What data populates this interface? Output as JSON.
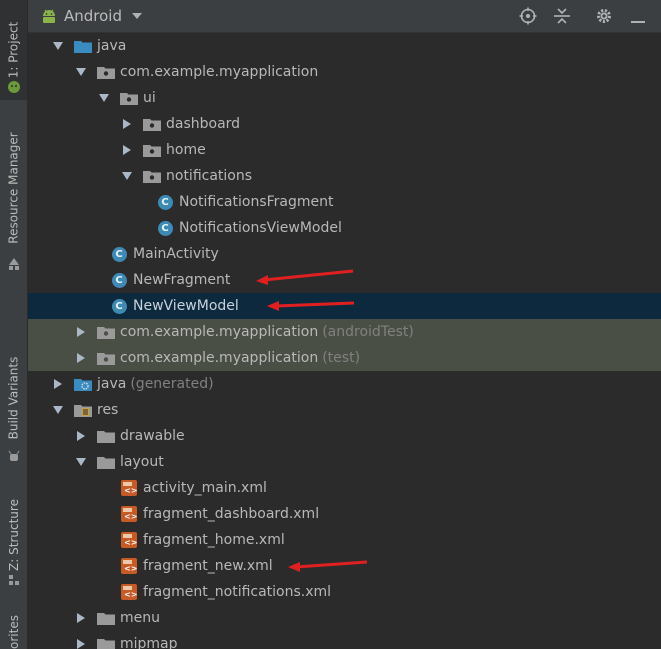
{
  "side_tabs": {
    "project": "1: Project",
    "resource_manager": "Resource Manager",
    "build_variants": "Build Variants",
    "structure": "Z: Structure",
    "favorites": "orites"
  },
  "toolbar": {
    "title": "Android"
  },
  "tree": {
    "java": "java",
    "package": "com.example.myapplication",
    "ui": "ui",
    "dashboard": "dashboard",
    "home": "home",
    "notifications": "notifications",
    "notifications_fragment": "NotificationsFragment",
    "notifications_viewmodel": "NotificationsViewModel",
    "main_activity": "MainActivity",
    "new_fragment": "NewFragment",
    "new_viewmodel": "NewViewModel",
    "package_android_test": "com.example.myapplication",
    "android_test_suffix": "(androidTest)",
    "package_test": "com.example.myapplication",
    "test_suffix": "(test)",
    "java_generated": "java",
    "generated_suffix": "(generated)",
    "res": "res",
    "drawable": "drawable",
    "layout": "layout",
    "activity_main": "activity_main.xml",
    "fragment_dashboard": "fragment_dashboard.xml",
    "fragment_home": "fragment_home.xml",
    "fragment_new": "fragment_new.xml",
    "fragment_notifications": "fragment_notifications.xml",
    "menu": "menu",
    "mipmap": "mipmap"
  },
  "colors": {
    "background": "#2b2b2b",
    "selection": "#0d293e",
    "test_highlight": "#4a4f45",
    "annotation_arrow": "#e02020",
    "class_icon": "#3d8bb4",
    "xml_icon": "#c85a26"
  }
}
